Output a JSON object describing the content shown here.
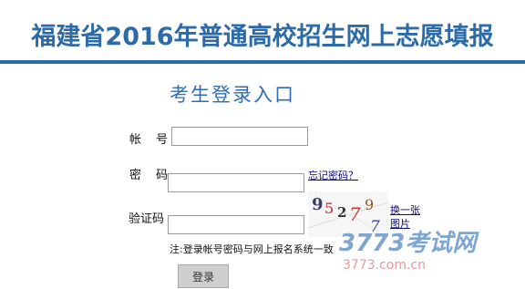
{
  "header": {
    "title": "福建省2016年普通高校招生网上志愿填报",
    "accent_color": "#2d6aa8"
  },
  "login": {
    "heading": "考生登录入口",
    "account_label": "帐 号",
    "account_value": "",
    "password_label": "密 码",
    "password_value": "",
    "forgot_password": "忘记密码？",
    "captcha_label": "验证码",
    "captcha_value": "",
    "captcha_chars": [
      "9",
      "5",
      "2",
      "7",
      "9",
      "7"
    ],
    "refresh_captcha": "换一张图片",
    "note": "注:登录帐号密码与网上报名系统一致",
    "submit_label": "登录"
  },
  "watermark": {
    "main": "3773考试网",
    "sub": "3773.com.cn"
  }
}
